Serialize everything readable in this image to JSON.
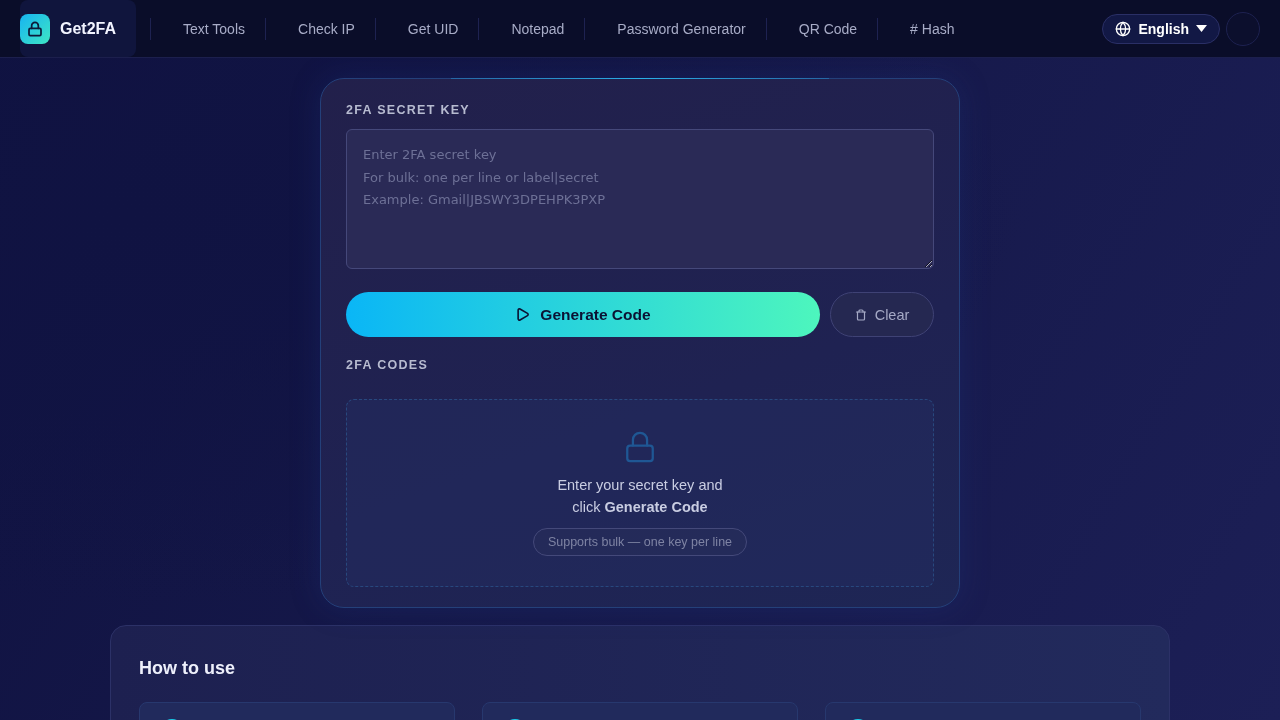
{
  "header": {
    "logo": {
      "text": "Get2FA"
    },
    "nav": [
      {
        "label": "Text Tools"
      },
      {
        "label": "Check IP"
      },
      {
        "label": "Get UID"
      },
      {
        "label": "Notepad"
      },
      {
        "label": "Password Generator"
      },
      {
        "label": "QR Code"
      },
      {
        "label": "# Hash"
      }
    ],
    "language": {
      "label": "English"
    }
  },
  "generator": {
    "secret_label": "2FA SECRET KEY",
    "secret_field": {
      "placeholder": "Enter 2FA secret key\nFor bulk: one per line or label|secret\nExample: Gmail|JBSWY3DPEHPK3PXP"
    },
    "buttons": [
      {
        "kind": "primary",
        "label": "Generate Code"
      },
      {
        "kind": "secondary",
        "label": "Clear"
      }
    ],
    "codes_label": "2FA CODES",
    "empty_state": {
      "message": "Enter your secret key and click **Generate Code**",
      "hint": "Supports bulk — one key per line"
    }
  },
  "how_to": {
    "title": "How to use",
    "steps": [
      {
        "kind": "step"
      },
      {
        "kind": "step"
      },
      {
        "kind": "step"
      }
    ]
  }
}
